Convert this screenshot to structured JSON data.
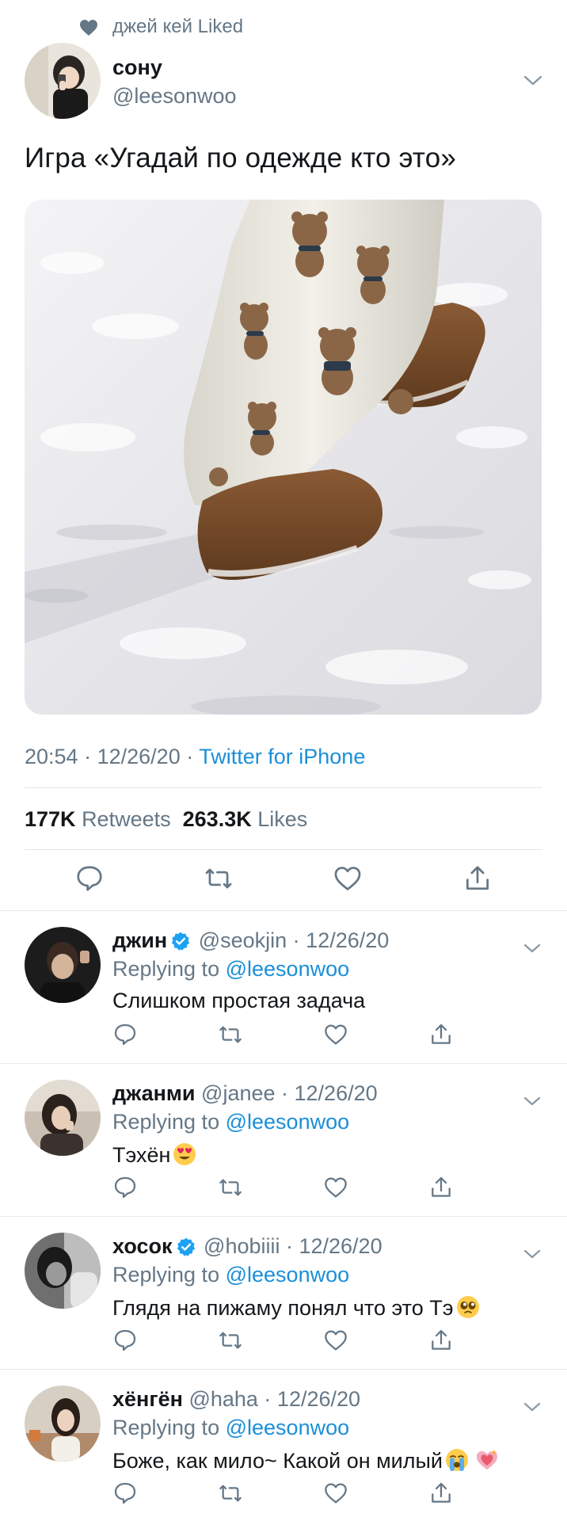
{
  "liked_by": {
    "text": "джей кей Liked",
    "icon": "heart-filled-icon"
  },
  "tweet": {
    "author_name": "сону",
    "author_handle": "@leesonwoo",
    "text": "Игра «Угадай по одежде кто это»",
    "photo_description": "photo-snow-boots",
    "time": "20:54",
    "date": "12/26/20",
    "separator": "·",
    "source": "Twitter for iPhone",
    "retweets_count": "177K",
    "retweets_label": "Retweets",
    "likes_count": "263.3K",
    "likes_label": "Likes"
  },
  "replies": [
    {
      "name": "джин",
      "verified": true,
      "handle": "@seokjin",
      "date": "12/26/20",
      "replying_prefix": "Replying to",
      "replying_to": "@leesonwoo",
      "text": "Слишком простая задача",
      "emojis": []
    },
    {
      "name": "джанми",
      "verified": false,
      "handle": "@janee",
      "date": "12/26/20",
      "replying_prefix": "Replying to",
      "replying_to": "@leesonwoo",
      "text": "Тэхён",
      "emojis": [
        "heart-eyes-emoji"
      ]
    },
    {
      "name": "хосок",
      "verified": true,
      "handle": "@hobiiii",
      "date": "12/26/20",
      "replying_prefix": "Replying to",
      "replying_to": "@leesonwoo",
      "text": "Глядя на пижаму понял что это Тэ",
      "emojis": [
        "pleading-face-emoji"
      ]
    },
    {
      "name": "хёнгён",
      "verified": false,
      "handle": "@haha",
      "date": "12/26/20",
      "replying_prefix": "Replying to",
      "replying_to": "@leesonwoo",
      "text": "Боже, как мило~ Какой он милый",
      "emojis": [
        "crying-face-emoji",
        "sparkling-heart-emoji"
      ]
    }
  ],
  "colors": {
    "text_primary": "#14171a",
    "text_secondary": "#657786",
    "link": "#1b8fd8",
    "divider": "#e1e8ed",
    "verified": "#1da1f2"
  }
}
